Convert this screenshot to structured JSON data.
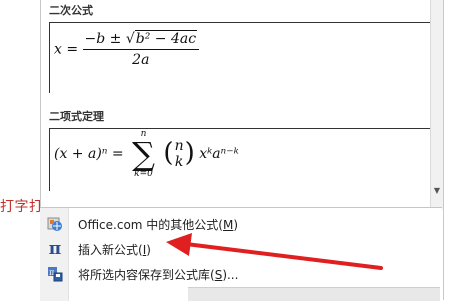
{
  "document": {
    "text": "打字打"
  },
  "gallery": {
    "sections": [
      {
        "title": "二次公式"
      },
      {
        "title": "二项式定理"
      }
    ],
    "formula1": {
      "lhs": "x =",
      "numerator_pre": "−b ±",
      "sqrt_content": "b² − 4ac",
      "denominator": "2a"
    },
    "formula2": {
      "lhs": "(x + a)ⁿ =",
      "sum_top": "n",
      "sum_bottom": "k=0",
      "binom_top": "n",
      "binom_bottom": "k",
      "rhs": "xᵏaⁿ⁻ᵏ"
    }
  },
  "menu": {
    "items": [
      {
        "label": "Office.com 中的其他公式(",
        "hotkey": "M",
        "suffix": ")",
        "icon": "office-web-icon"
      },
      {
        "label": "插入新公式(",
        "hotkey": "I",
        "suffix": ")",
        "icon": "pi-icon"
      },
      {
        "label": "将所选内容保存到公式库(",
        "hotkey": "S",
        "suffix": ")...",
        "icon": "save-equation-icon"
      }
    ]
  },
  "colors": {
    "annotation_arrow": "#e02020",
    "doc_text": "#c0322b"
  }
}
